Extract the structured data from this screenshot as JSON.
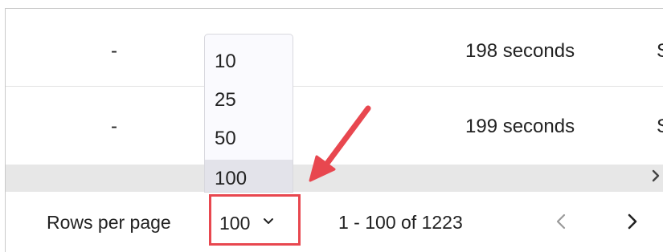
{
  "table": {
    "rows": [
      {
        "col1": "-",
        "duration": "198 seconds",
        "next": "S"
      },
      {
        "col1": "-",
        "duration": "199 seconds",
        "next": "S"
      }
    ]
  },
  "scrollbar": {
    "right_arrow_icon": "chevron-right-icon"
  },
  "pagination": {
    "rows_per_page_label": "Rows per page",
    "rows_per_page_value": "100",
    "range_text": "1 - 100 of 1223",
    "prev_icon": "chevron-left-icon",
    "next_icon": "chevron-right-icon"
  },
  "dropdown": {
    "options": [
      "10",
      "25",
      "50",
      "100"
    ],
    "selected": "100"
  },
  "annotation": {
    "color": "#e8474f"
  }
}
